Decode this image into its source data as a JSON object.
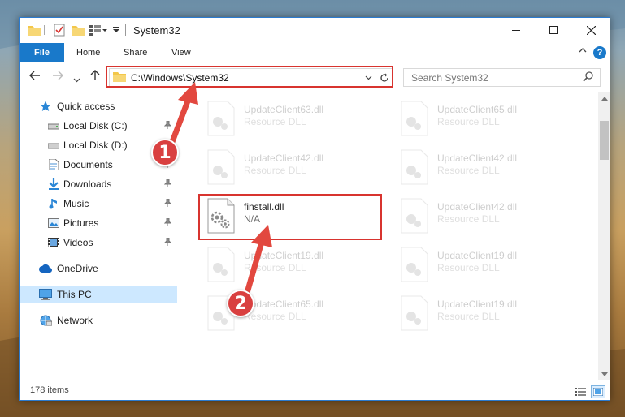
{
  "window": {
    "title": "System32"
  },
  "ribbon": {
    "tabs": [
      "File",
      "Home",
      "Share",
      "View"
    ],
    "help": "?"
  },
  "address": {
    "path": "C:\\Windows\\System32"
  },
  "search": {
    "placeholder": "Search System32"
  },
  "sidebar": {
    "items": [
      {
        "label": "Quick access",
        "icon": "star-icon",
        "pinned": false
      },
      {
        "label": "Local Disk (C:)",
        "icon": "drive-icon",
        "pinned": true
      },
      {
        "label": "Local Disk (D:)",
        "icon": "drive-icon",
        "pinned": true
      },
      {
        "label": "Documents",
        "icon": "documents-icon",
        "pinned": true
      },
      {
        "label": "Downloads",
        "icon": "download-icon",
        "pinned": true
      },
      {
        "label": "Music",
        "icon": "music-icon",
        "pinned": true
      },
      {
        "label": "Pictures",
        "icon": "pictures-icon",
        "pinned": true
      },
      {
        "label": "Videos",
        "icon": "videos-icon",
        "pinned": true
      },
      {
        "label": "OneDrive",
        "icon": "cloud-icon",
        "pinned": false
      },
      {
        "label": "This PC",
        "icon": "computer-icon",
        "pinned": false,
        "selected": true
      },
      {
        "label": "Network",
        "icon": "network-icon",
        "pinned": false
      }
    ]
  },
  "files": {
    "left_column": [
      {
        "name": "UpdateClient63.dll",
        "type": "Resource DLL"
      },
      {
        "name": "UpdateClient42.dll",
        "type": "Resource DLL"
      },
      {
        "name": "finstall.dll",
        "type": "N/A",
        "highlighted": true
      },
      {
        "name": "UpdateClient19.dll",
        "type": "Resource DLL"
      },
      {
        "name": "UpdateClient65.dll",
        "type": "Resource DLL"
      }
    ],
    "right_column": [
      {
        "name": "UpdateClient65.dll",
        "type": "Resource DLL"
      },
      {
        "name": "UpdateClient42.dll",
        "type": "Resource DLL"
      },
      {
        "name": "UpdateClient42.dll",
        "type": "Resource DLL"
      },
      {
        "name": "UpdateClient19.dll",
        "type": "Resource DLL"
      },
      {
        "name": "UpdateClient19.dll",
        "type": "Resource DLL"
      }
    ]
  },
  "status": {
    "items_count": "178 items"
  },
  "callouts": [
    "1",
    "2"
  ],
  "colors": {
    "accent": "#1979ca",
    "highlight": "#d8342f",
    "selected": "#cde8ff"
  }
}
